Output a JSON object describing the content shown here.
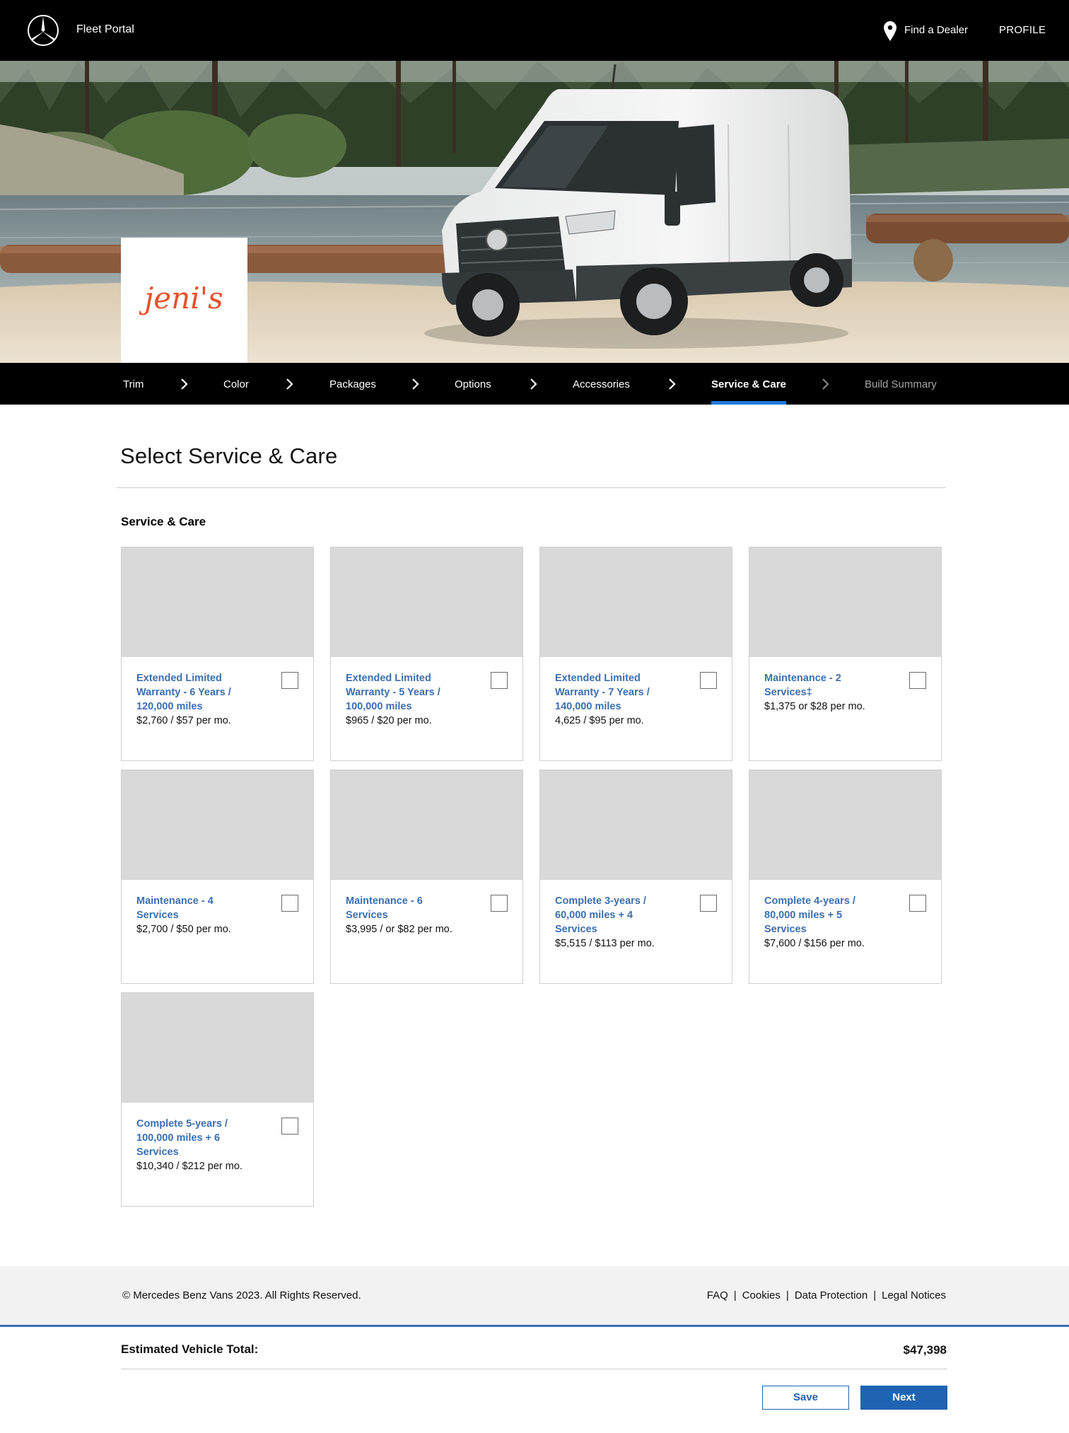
{
  "header": {
    "brand_label": "Fleet Portal",
    "dealer_link": "Find a Dealer",
    "profile_link": "PROFILE",
    "logo_icon": "three-pointed-star-icon",
    "location_icon": "map-pin-icon"
  },
  "hero": {
    "dealer_logo_text": "jeni's",
    "dealer_logo_color": "#e8502a"
  },
  "steps": [
    {
      "label": "Trim",
      "state": "done"
    },
    {
      "label": "Color",
      "state": "done"
    },
    {
      "label": "Packages",
      "state": "done"
    },
    {
      "label": "Options",
      "state": "done"
    },
    {
      "label": "Accessories",
      "state": "done"
    },
    {
      "label": "Service & Care",
      "state": "active"
    },
    {
      "label": "Build Summary",
      "state": "upcoming"
    }
  ],
  "main": {
    "title": "Select Service & Care",
    "section_label": "Service & Care",
    "cards": [
      {
        "title": "Extended Limited Warranty - 6 Years / 120,000 miles",
        "price": "$2,760 / $57 per mo.",
        "checked": false
      },
      {
        "title": "Extended Limited Warranty - 5 Years / 100,000 miles",
        "price": "$965 / $20 per mo.",
        "checked": false
      },
      {
        "title": "Extended Limited Warranty - 7 Years / 140,000 miles",
        "price": "4,625 / $95 per mo.",
        "checked": false
      },
      {
        "title": "Maintenance - 2 Services‡",
        "price": "$1,375 or $28 per mo.",
        "checked": false
      },
      {
        "title": "Maintenance - 4 Services",
        "price": "$2,700 / $50 per mo.",
        "checked": false
      },
      {
        "title": "Maintenance - 6 Services",
        "price": "$3,995 / or $82 per mo.",
        "checked": false
      },
      {
        "title": "Complete 3-years / 60,000 miles + 4 Services",
        "price": "$5,515 / $113 per mo.",
        "checked": false
      },
      {
        "title": "Complete 4-years / 80,000 miles + 5 Services",
        "price": "$7,600 / $156 per mo.",
        "checked": false
      },
      {
        "title": "Complete 5-years / 100,000 miles + 6 Services",
        "price": "$10,340 / $212 per mo.",
        "checked": false
      }
    ]
  },
  "footer": {
    "copyright": "© Mercedes Benz Vans 2023. All Rights Reserved.",
    "links": [
      "FAQ",
      "Cookies",
      "Data Protection",
      "Legal Notices"
    ]
  },
  "summary": {
    "total_label": "Estimated Vehicle Total:",
    "total_value": "$47,398",
    "save_label": "Save",
    "next_label": "Next"
  },
  "colors": {
    "accent": "#1f63b2",
    "link_blue": "#3c6fb0",
    "active_underline": "#1e7bd9",
    "header_bg": "#000000",
    "placeholder_gray": "#d9d9d9"
  }
}
